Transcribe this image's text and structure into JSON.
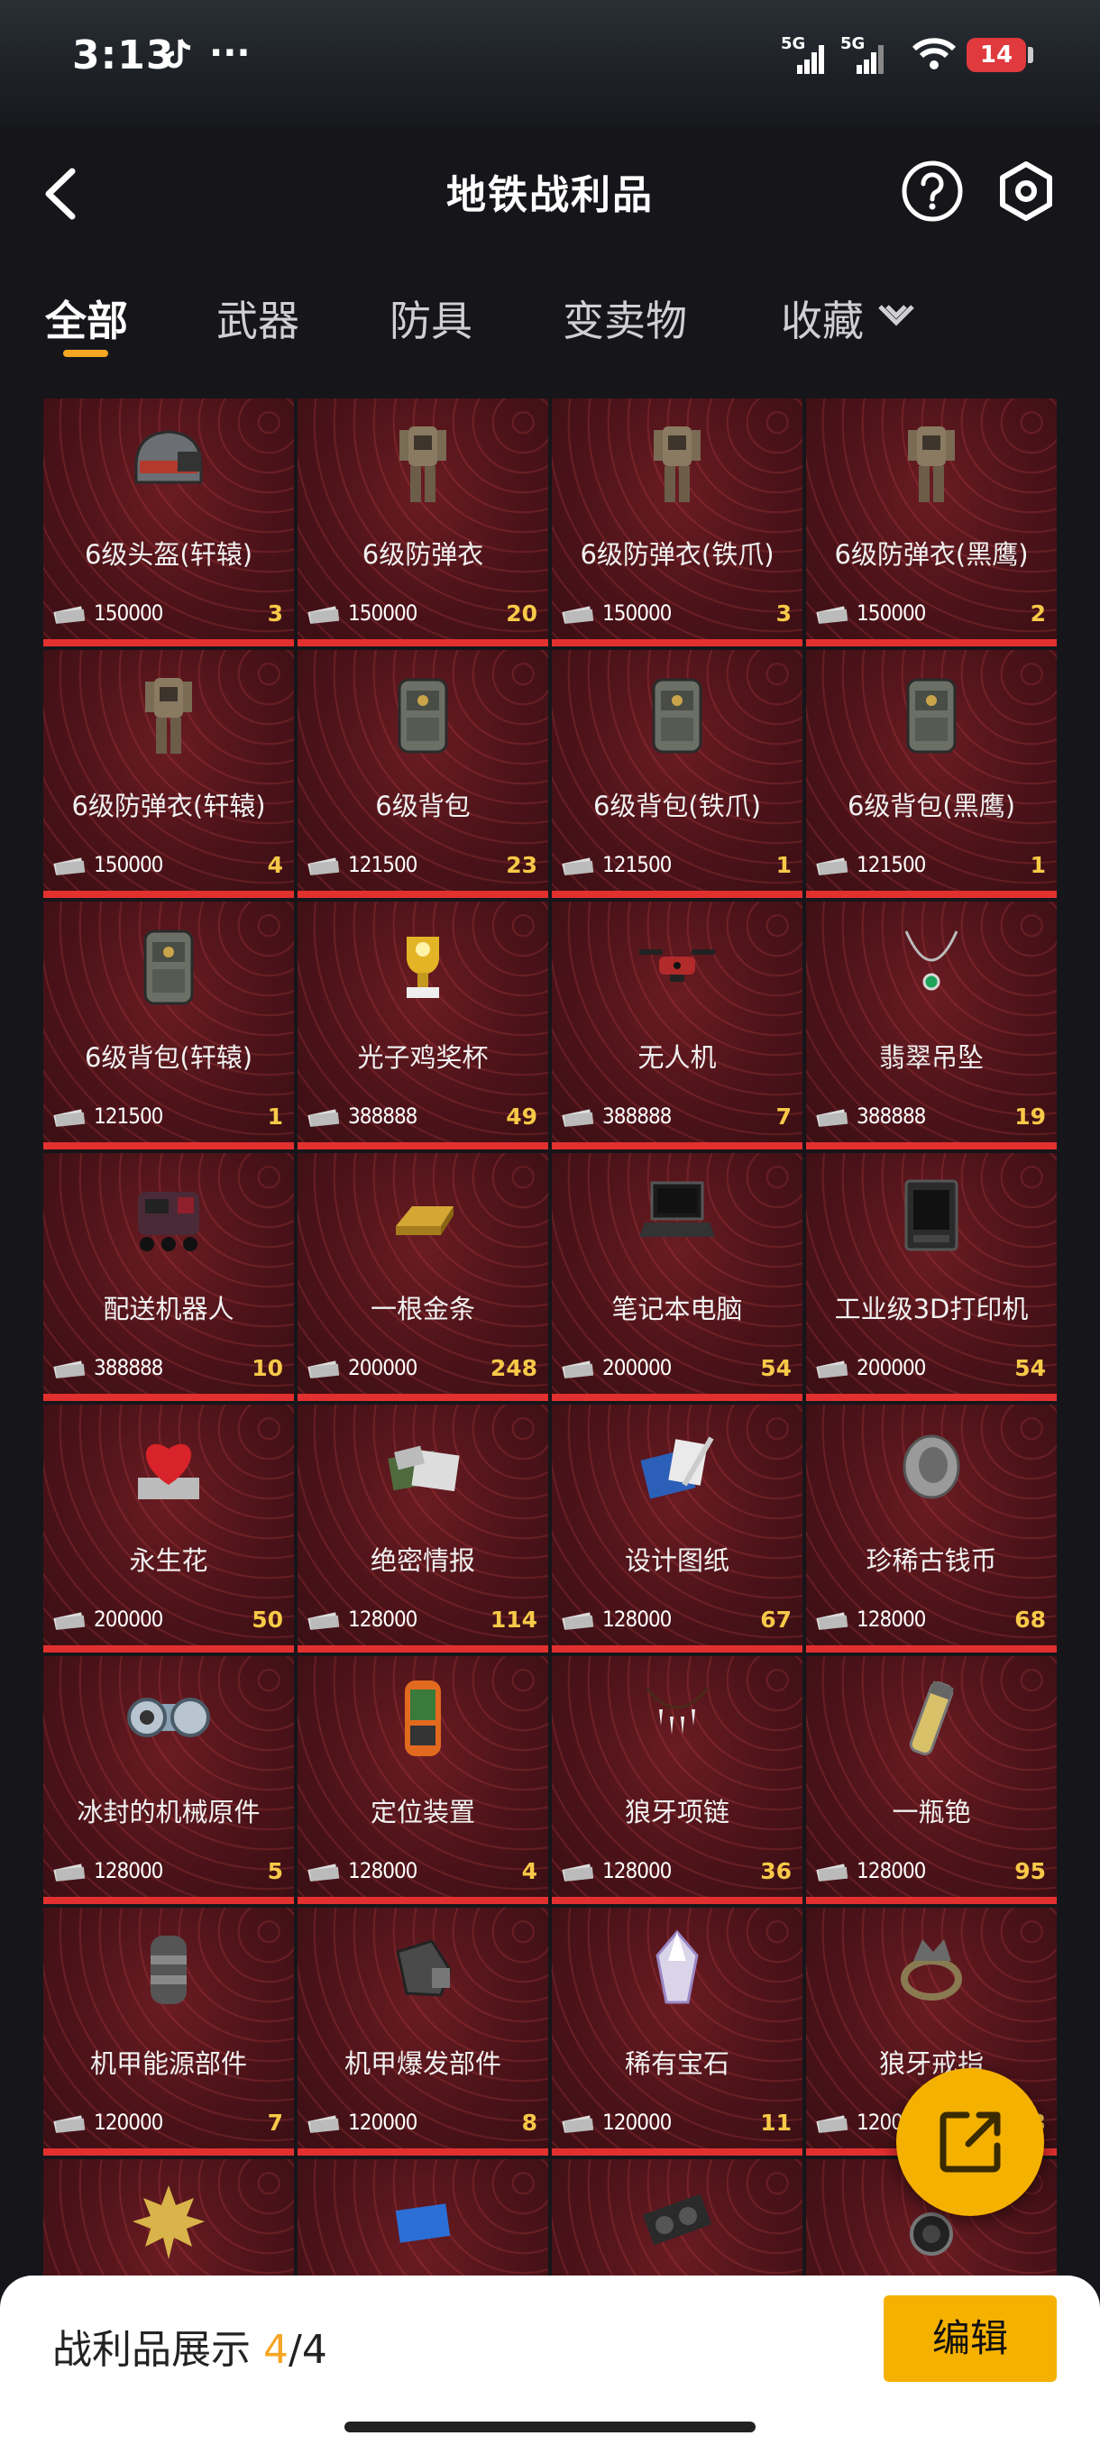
{
  "status_bar": {
    "time": "3:13",
    "dots": "···",
    "signal1": "5G",
    "signal2": "5G",
    "battery": "14"
  },
  "header": {
    "title": "地铁战利品"
  },
  "tabs": [
    {
      "label": "全部",
      "active": true
    },
    {
      "label": "武器",
      "active": false
    },
    {
      "label": "防具",
      "active": false
    },
    {
      "label": "变卖物",
      "active": false
    },
    {
      "label": "收藏",
      "active": false
    }
  ],
  "items": [
    {
      "name": "6级头盔(轩辕)",
      "price": "150000",
      "count": "3",
      "icon": "helmet"
    },
    {
      "name": "6级防弹衣",
      "price": "150000",
      "count": "20",
      "icon": "armor"
    },
    {
      "name": "6级防弹衣(铁爪)",
      "price": "150000",
      "count": "3",
      "icon": "armor"
    },
    {
      "name": "6级防弹衣(黑鹰)",
      "price": "150000",
      "count": "2",
      "icon": "armor"
    },
    {
      "name": "6级防弹衣(轩辕)",
      "price": "150000",
      "count": "4",
      "icon": "armor"
    },
    {
      "name": "6级背包",
      "price": "121500",
      "count": "23",
      "icon": "backpack"
    },
    {
      "name": "6级背包(铁爪)",
      "price": "121500",
      "count": "1",
      "icon": "backpack"
    },
    {
      "name": "6级背包(黑鹰)",
      "price": "121500",
      "count": "1",
      "icon": "backpack"
    },
    {
      "name": "6级背包(轩辕)",
      "price": "121500",
      "count": "1",
      "icon": "backpack"
    },
    {
      "name": "光子鸡奖杯",
      "price": "388888",
      "count": "49",
      "icon": "trophy"
    },
    {
      "name": "无人机",
      "price": "388888",
      "count": "7",
      "icon": "drone"
    },
    {
      "name": "翡翠吊坠",
      "price": "388888",
      "count": "19",
      "icon": "necklace"
    },
    {
      "name": "配送机器人",
      "price": "388888",
      "count": "10",
      "icon": "robot"
    },
    {
      "name": "一根金条",
      "price": "200000",
      "count": "248",
      "icon": "gold-bar"
    },
    {
      "name": "笔记本电脑",
      "price": "200000",
      "count": "54",
      "icon": "laptop"
    },
    {
      "name": "工业级3D打印机",
      "price": "200000",
      "count": "54",
      "icon": "printer"
    },
    {
      "name": "永生花",
      "price": "200000",
      "count": "50",
      "icon": "heart-flower"
    },
    {
      "name": "绝密情报",
      "price": "128000",
      "count": "114",
      "icon": "documents"
    },
    {
      "name": "设计图纸",
      "price": "128000",
      "count": "67",
      "icon": "blueprint"
    },
    {
      "name": "珍稀古钱币",
      "price": "128000",
      "count": "68",
      "icon": "coin"
    },
    {
      "name": "冰封的机械原件",
      "price": "128000",
      "count": "5",
      "icon": "machine-part"
    },
    {
      "name": "定位装置",
      "price": "128000",
      "count": "4",
      "icon": "gps"
    },
    {
      "name": "狼牙项链",
      "price": "128000",
      "count": "36",
      "icon": "fang-necklace"
    },
    {
      "name": "一瓶铯",
      "price": "128000",
      "count": "95",
      "icon": "vial"
    },
    {
      "name": "机甲能源部件",
      "price": "120000",
      "count": "7",
      "icon": "energy-part"
    },
    {
      "name": "机甲爆发部件",
      "price": "120000",
      "count": "8",
      "icon": "burst-part"
    },
    {
      "name": "稀有宝石",
      "price": "120000",
      "count": "11",
      "icon": "gem"
    },
    {
      "name": "狼牙戒指",
      "price": "120000",
      "count": "3",
      "icon": "ring"
    },
    {
      "name": "",
      "price": "",
      "count": "",
      "icon": "maple-leaf"
    },
    {
      "name": "",
      "price": "",
      "count": "",
      "icon": "blue-card"
    },
    {
      "name": "",
      "price": "",
      "count": "",
      "icon": "graphics-card"
    },
    {
      "name": "",
      "price": "",
      "count": "",
      "icon": "lens"
    }
  ],
  "bottom": {
    "showcase_label": "战利品展示",
    "showcase_current": "4",
    "showcase_total": "/4",
    "edit_label": "编辑"
  }
}
